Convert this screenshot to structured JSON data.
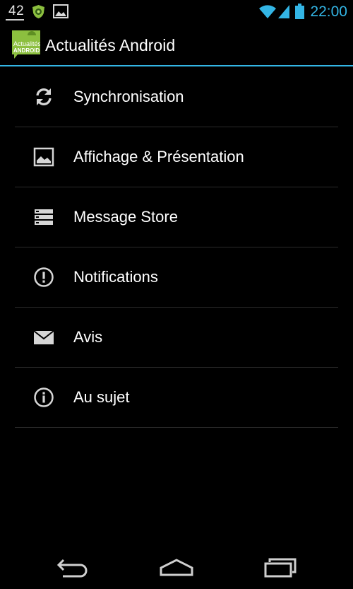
{
  "status_bar": {
    "temperature": "42",
    "time": "22:00",
    "icons": [
      "shield-icon",
      "gallery-icon",
      "wifi-icon",
      "signal-icon",
      "battery-icon"
    ]
  },
  "action_bar": {
    "logo_line1": "Actualités",
    "logo_line2": "ANDROID",
    "title": "Actualités Android"
  },
  "settings": {
    "items": [
      {
        "label": "Synchronisation",
        "icon": "sync-icon"
      },
      {
        "label": "Affichage & Présentation",
        "icon": "image-icon"
      },
      {
        "label": "Message Store",
        "icon": "storage-icon"
      },
      {
        "label": "Notifications",
        "icon": "alert-icon"
      },
      {
        "label": "Avis",
        "icon": "mail-icon"
      },
      {
        "label": "Au sujet",
        "icon": "info-icon"
      }
    ]
  },
  "nav_bar": {
    "buttons": [
      "back",
      "home",
      "recent-apps"
    ]
  },
  "colors": {
    "accent": "#33b5e5",
    "background": "#000000",
    "divider": "#2a2a2a",
    "logo_green": "#8cbf3f"
  }
}
